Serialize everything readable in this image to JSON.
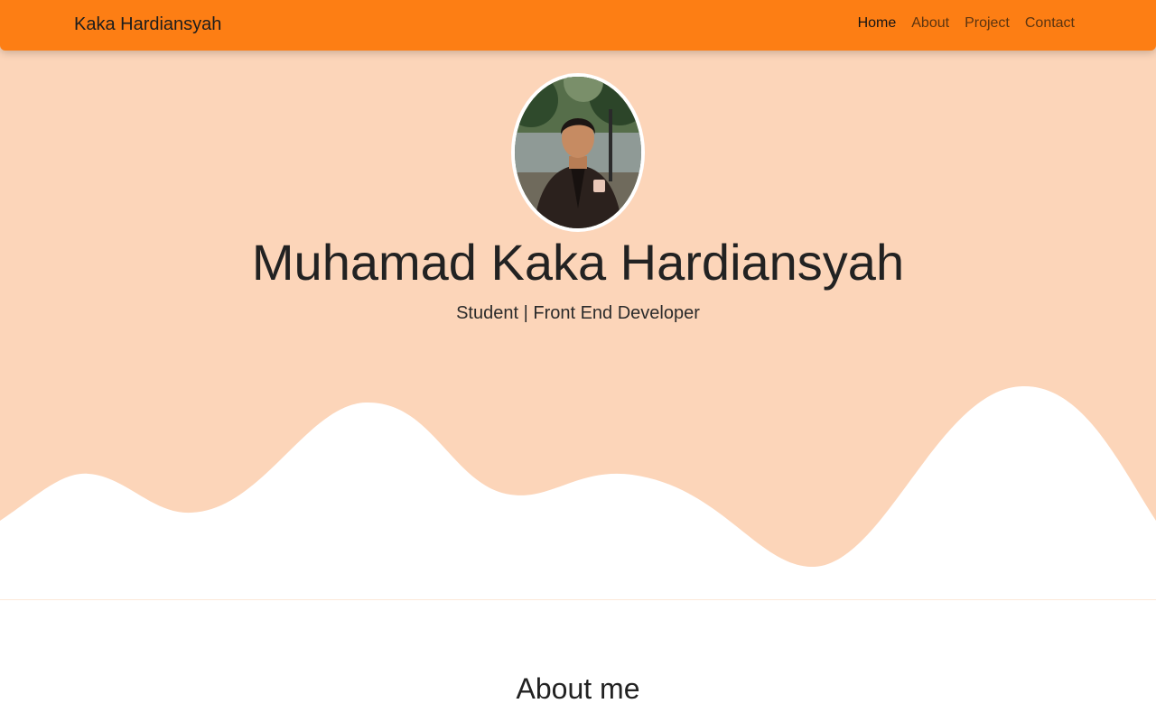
{
  "navbar": {
    "brand": "Kaka Hardiansyah",
    "links": [
      {
        "label": "Home",
        "active": true
      },
      {
        "label": "About",
        "active": false
      },
      {
        "label": "Project",
        "active": false
      },
      {
        "label": "Contact",
        "active": false
      }
    ]
  },
  "hero": {
    "title": "Muhamad Kaka Hardiansyah",
    "subtitle": "Student | Front End Developer",
    "avatar_icon": "profile-photo"
  },
  "about": {
    "heading": "About me"
  },
  "colors": {
    "navbar": "#fd7e14",
    "hero_background": "#fcd5b9",
    "wave": "#ffffff"
  }
}
